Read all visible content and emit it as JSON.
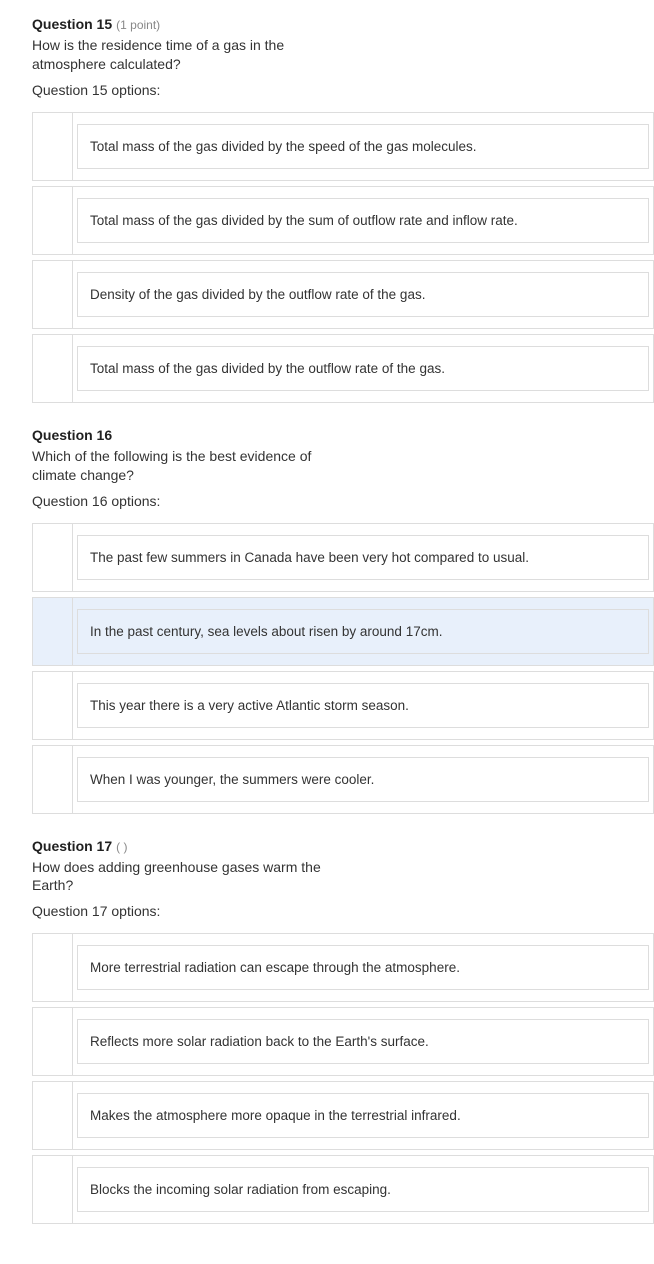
{
  "questions": [
    {
      "number": "Question 15",
      "points": "(1 point)",
      "text": "How is the residence time of a gas in the atmosphere calculated?",
      "options_label": "Question 15 options:",
      "options": [
        {
          "text": "Total mass of the gas divided by the speed of the gas molecules.",
          "selected": false
        },
        {
          "text": "Total mass of the gas divided by the sum of outflow rate and inflow rate.",
          "selected": false
        },
        {
          "text": "Density of the gas divided by the outflow rate of the gas.",
          "selected": false
        },
        {
          "text": "Total mass of the gas divided by the outflow rate of the gas.",
          "selected": false
        }
      ]
    },
    {
      "number": "Question 16",
      "points": " ",
      "text": "Which of the following is the best evidence of climate change?",
      "options_label": "Question 16 options:",
      "options": [
        {
          "text": "The past few summers in Canada have been very hot compared to usual.",
          "selected": false
        },
        {
          "text": "In the past century, sea levels about risen by around 17cm.",
          "selected": true
        },
        {
          "text": "This year there is a very active Atlantic storm season.",
          "selected": false
        },
        {
          "text": "When I was younger, the summers were cooler.",
          "selected": false
        }
      ]
    },
    {
      "number": "Question 17",
      "points": "(    )",
      "text": "How does adding greenhouse gases warm the Earth?",
      "options_label": "Question 17 options:",
      "options": [
        {
          "text": "More terrestrial radiation can escape through the atmosphere.",
          "selected": false
        },
        {
          "text": "Reflects more solar radiation back to the Earth's surface.",
          "selected": false
        },
        {
          "text": "Makes the atmosphere more opaque in the terrestrial infrared.",
          "selected": false
        },
        {
          "text": "Blocks the incoming solar radiation from escaping.",
          "selected": false
        }
      ]
    }
  ]
}
